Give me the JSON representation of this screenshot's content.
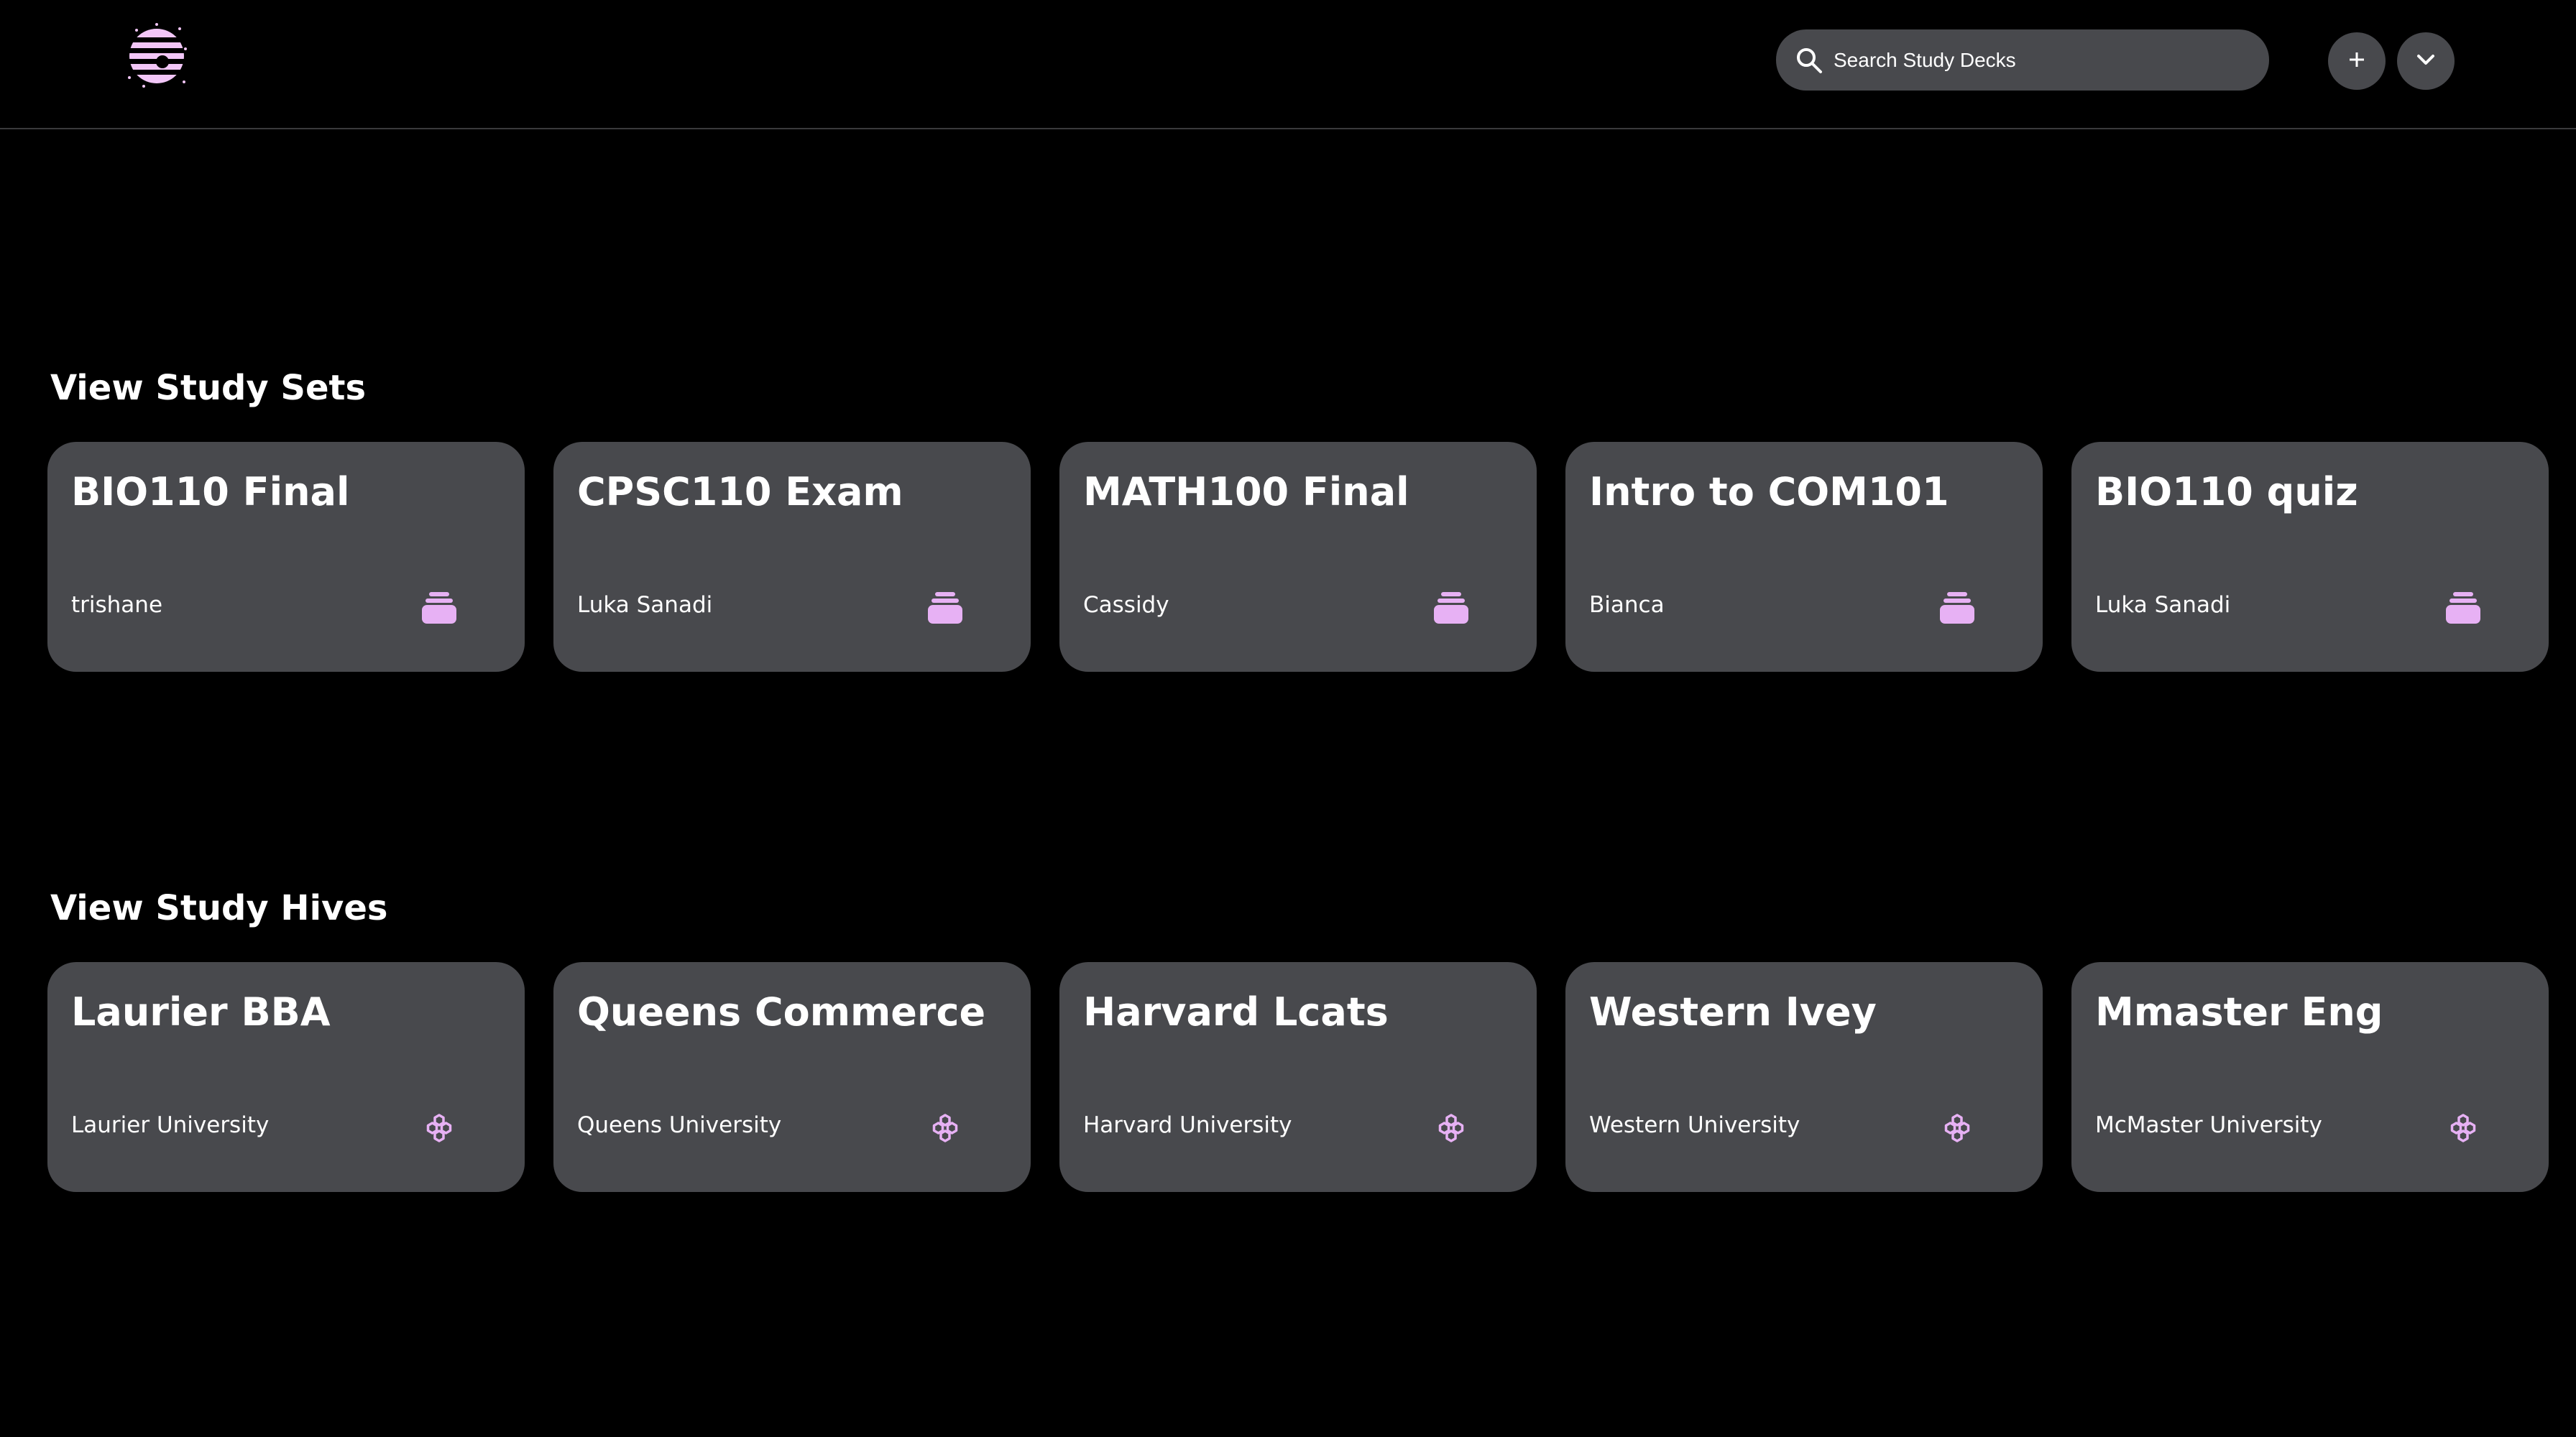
{
  "header": {
    "search": {
      "placeholder": "Search Study Decks",
      "value": ""
    },
    "logo_icon": "beehive-logo-icon",
    "add_icon": "plus-icon",
    "menu_icon": "chevron-down-icon"
  },
  "colors": {
    "background": "#000000",
    "card": "#48494d",
    "accent": "#e7b1f4",
    "text": "#ffffff"
  },
  "sets": {
    "title": "View Study Sets",
    "icon": "stack-icon",
    "items": [
      {
        "title": "BIO110 Final",
        "author": "trishane"
      },
      {
        "title": "CPSC110 Exam",
        "author": "Luka Sanadi"
      },
      {
        "title": "MATH100 Final",
        "author": "Cassidy"
      },
      {
        "title": "Intro to COM101",
        "author": "Bianca"
      },
      {
        "title": "BIO110 quiz",
        "author": "Luka Sanadi"
      }
    ]
  },
  "hives": {
    "title": "View Study Hives",
    "icon": "honeycomb-icon",
    "items": [
      {
        "title": "Laurier BBA",
        "school": "Laurier University"
      },
      {
        "title": "Queens Commerce",
        "school": "Queens University"
      },
      {
        "title": "Harvard Lcats",
        "school": "Harvard University"
      },
      {
        "title": "Western Ivey",
        "school": "Western University"
      },
      {
        "title": "Mmaster Eng",
        "school": "McMaster University"
      }
    ]
  }
}
